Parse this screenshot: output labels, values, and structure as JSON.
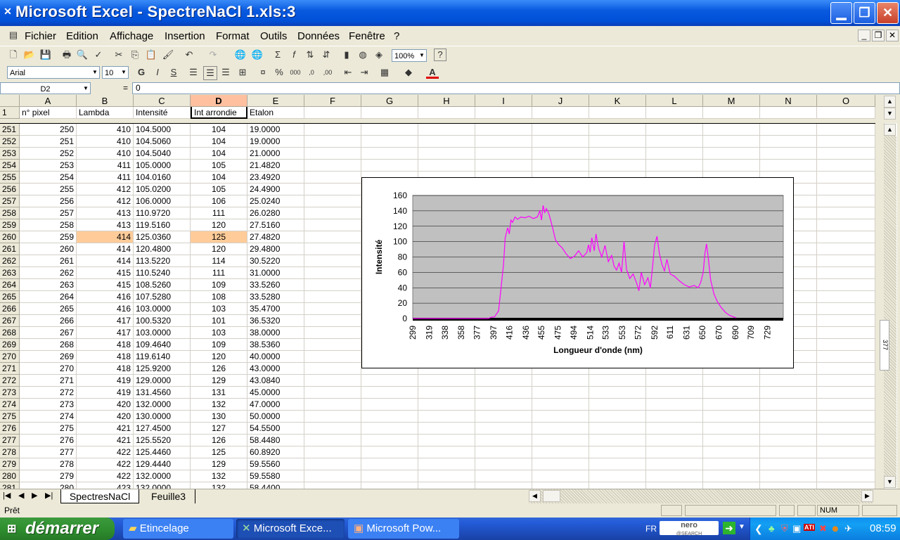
{
  "window": {
    "title": "Microsoft Excel - SpectreNaCl 1.xls:3"
  },
  "menu": [
    "Fichier",
    "Edition",
    "Affichage",
    "Insertion",
    "Format",
    "Outils",
    "Données",
    "Fenêtre",
    "?"
  ],
  "toolbar": {
    "zoom": "100%",
    "font": "Arial",
    "font_size": "10"
  },
  "formula": {
    "namebox": "D2",
    "eq": "=",
    "value": "0"
  },
  "grid": {
    "columns": [
      "A",
      "B",
      "C",
      "D",
      "E",
      "F",
      "G",
      "H",
      "I",
      "J",
      "K",
      "L",
      "M",
      "N",
      "O"
    ],
    "frozen_row": {
      "num": "1",
      "cells": [
        "n° pixel",
        "Lambda",
        "Intensité",
        "Int arrondie",
        "Etalon"
      ]
    },
    "rows": [
      [
        "251",
        "250",
        "410",
        "104.5000",
        "104",
        "19.0000"
      ],
      [
        "252",
        "251",
        "410",
        "104.5060",
        "104",
        "19.0000"
      ],
      [
        "253",
        "252",
        "410",
        "104.5040",
        "104",
        "21.0000"
      ],
      [
        "254",
        "253",
        "411",
        "105.0000",
        "105",
        "21.4820"
      ],
      [
        "255",
        "254",
        "411",
        "104.0160",
        "104",
        "23.4920"
      ],
      [
        "256",
        "255",
        "412",
        "105.0200",
        "105",
        "24.4900"
      ],
      [
        "257",
        "256",
        "412",
        "106.0000",
        "106",
        "25.0240"
      ],
      [
        "258",
        "257",
        "413",
        "110.9720",
        "111",
        "26.0280"
      ],
      [
        "259",
        "258",
        "413",
        "119.5160",
        "120",
        "27.5160"
      ],
      [
        "260",
        "259",
        "414",
        "125.0360",
        "125",
        "27.4820"
      ],
      [
        "261",
        "260",
        "414",
        "120.4800",
        "120",
        "29.4800"
      ],
      [
        "262",
        "261",
        "414",
        "113.5220",
        "114",
        "30.5220"
      ],
      [
        "263",
        "262",
        "415",
        "110.5240",
        "111",
        "31.0000"
      ],
      [
        "264",
        "263",
        "415",
        "108.5260",
        "109",
        "33.5260"
      ],
      [
        "265",
        "264",
        "416",
        "107.5280",
        "108",
        "33.5280"
      ],
      [
        "266",
        "265",
        "416",
        "103.0000",
        "103",
        "35.4700"
      ],
      [
        "267",
        "266",
        "417",
        "100.5320",
        "101",
        "36.5320"
      ],
      [
        "268",
        "267",
        "417",
        "103.0000",
        "103",
        "38.0000"
      ],
      [
        "269",
        "268",
        "418",
        "109.4640",
        "109",
        "38.5360"
      ],
      [
        "270",
        "269",
        "418",
        "119.6140",
        "120",
        "40.0000"
      ],
      [
        "271",
        "270",
        "418",
        "125.9200",
        "126",
        "43.0000"
      ],
      [
        "272",
        "271",
        "419",
        "129.0000",
        "129",
        "43.0840"
      ],
      [
        "273",
        "272",
        "419",
        "131.4560",
        "131",
        "45.0000"
      ],
      [
        "274",
        "273",
        "420",
        "132.0000",
        "132",
        "47.0000"
      ],
      [
        "275",
        "274",
        "420",
        "130.0000",
        "130",
        "50.0000"
      ],
      [
        "276",
        "275",
        "421",
        "127.4500",
        "127",
        "54.5500"
      ],
      [
        "277",
        "276",
        "421",
        "125.5520",
        "126",
        "58.4480"
      ],
      [
        "278",
        "277",
        "422",
        "125.4460",
        "125",
        "60.8920"
      ],
      [
        "279",
        "278",
        "422",
        "129.4440",
        "129",
        "59.5560"
      ],
      [
        "280",
        "279",
        "422",
        "132.0000",
        "132",
        "59.5580"
      ],
      [
        "281",
        "280",
        "423",
        "132.0000",
        "132",
        "58.4400"
      ]
    ],
    "highlight_row": "260"
  },
  "chart_data": {
    "type": "line",
    "title": "",
    "xlabel": "Longueur d'onde (nm)",
    "ylabel": "Intensité",
    "ylim": [
      0,
      160
    ],
    "yticks": [
      "0",
      "20",
      "40",
      "60",
      "80",
      "100",
      "120",
      "140",
      "160"
    ],
    "xticks": [
      "299",
      "319",
      "338",
      "358",
      "377",
      "397",
      "416",
      "436",
      "455",
      "475",
      "494",
      "514",
      "533",
      "553",
      "572",
      "592",
      "611",
      "631",
      "650",
      "670",
      "690",
      "709",
      "729"
    ],
    "xlim": [
      299,
      748
    ],
    "plot_background": "#c0c0c0",
    "series": [
      {
        "color": "#ff00ff",
        "x": [
          299,
          385,
          390,
          395,
          398,
          403,
          406,
          409,
          411,
          414,
          416,
          418,
          420,
          423,
          426,
          430,
          435,
          440,
          445,
          450,
          453,
          455,
          457,
          459,
          461,
          464,
          468,
          472,
          476,
          480,
          485,
          490,
          495,
          500,
          505,
          510,
          512,
          514,
          516,
          519,
          521,
          524,
          528,
          532,
          536,
          540,
          543,
          546,
          549,
          552,
          555,
          558,
          562,
          566,
          570,
          573,
          576,
          580,
          584,
          587,
          590,
          592,
          595,
          598,
          601,
          604,
          607,
          611,
          616,
          622,
          628,
          634,
          640,
          645,
          648,
          651,
          653,
          655,
          657,
          660,
          664,
          668,
          673,
          678,
          683,
          688,
          691
        ],
        "y": [
          0,
          0,
          0,
          2,
          2,
          10,
          40,
          70,
          105,
          118,
          110,
          128,
          125,
          132,
          129,
          132,
          131,
          133,
          130,
          132,
          140,
          128,
          147,
          138,
          143,
          136,
          120,
          102,
          96,
          92,
          84,
          78,
          81,
          88,
          80,
          86,
          96,
          86,
          105,
          88,
          110,
          92,
          80,
          95,
          74,
          82,
          68,
          63,
          72,
          60,
          100,
          64,
          52,
          58,
          47,
          36,
          60,
          44,
          53,
          40,
          72,
          95,
          107,
          84,
          70,
          62,
          77,
          58,
          55,
          49,
          44,
          41,
          43,
          40,
          47,
          60,
          84,
          97,
          80,
          50,
          32,
          22,
          14,
          8,
          4,
          2,
          1
        ]
      }
    ]
  },
  "sheet_tabs": [
    "SpectresNaCl",
    "Feuille3"
  ],
  "status": {
    "text": "Prêt",
    "num": "NUM"
  },
  "taskbar": {
    "start": "démarrer",
    "tasks": [
      "Etincelage",
      "Microsoft Exce...",
      "Microsoft Pow..."
    ],
    "lang": "FR",
    "search_logo": "nero",
    "search_sub": "@SEARCH",
    "clock": "08:59"
  },
  "vscroll_label": "377"
}
